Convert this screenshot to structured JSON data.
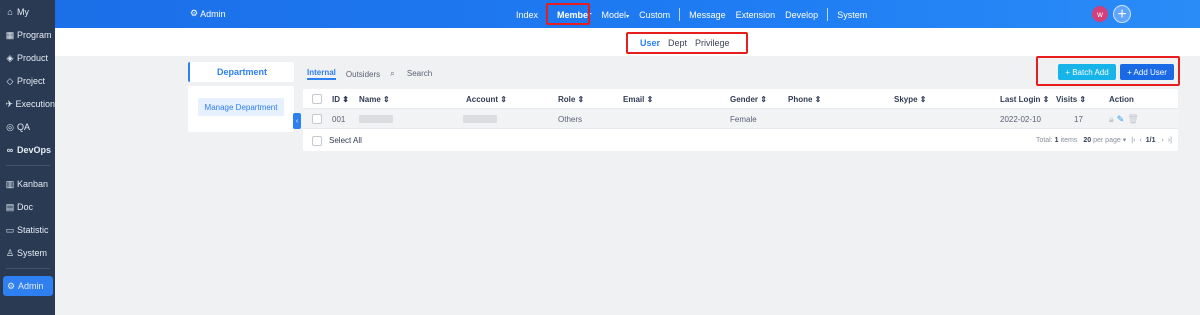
{
  "sidebar": {
    "items": [
      {
        "icon": "home-icon",
        "glyph": "⌂",
        "label": "My"
      },
      {
        "icon": "program-icon",
        "glyph": "▦",
        "label": "Program"
      },
      {
        "icon": "product-icon",
        "glyph": "◈",
        "label": "Product"
      },
      {
        "icon": "project-icon",
        "glyph": "◇",
        "label": "Project"
      },
      {
        "icon": "execution-icon",
        "glyph": "✈",
        "label": "Execution"
      },
      {
        "icon": "qa-icon",
        "glyph": "◎",
        "label": "QA"
      },
      {
        "icon": "devops-icon",
        "glyph": "∞",
        "label": "DevOps"
      },
      {
        "icon": "kanban-icon",
        "glyph": "▥",
        "label": "Kanban"
      },
      {
        "icon": "doc-icon",
        "glyph": "▤",
        "label": "Doc"
      },
      {
        "icon": "statistic-icon",
        "glyph": "▭",
        "label": "Statistic"
      },
      {
        "icon": "system-icon",
        "glyph": "♙",
        "label": "System"
      },
      {
        "icon": "admin-icon",
        "glyph": "⚙",
        "label": "Admin"
      }
    ]
  },
  "header": {
    "title": "Admin",
    "nav": [
      "Index",
      "Member",
      "Model",
      "Custom",
      "Message",
      "Extension",
      "Develop",
      "System"
    ],
    "active": "Member",
    "model_caret": "▾",
    "avatar_letter": "w",
    "plus": "+"
  },
  "subnav": {
    "items": [
      "User",
      "Dept",
      "Privilege"
    ],
    "active": "User"
  },
  "department": {
    "tab_label": "Department",
    "manage_label": "Manage Department",
    "collapse": "‹"
  },
  "toolbar": {
    "tabs": [
      "Internal",
      "Outsiders",
      "Search"
    ],
    "active_tab": "Internal",
    "search_glyph": "⌕",
    "batch_add": "+ Batch Add",
    "add_user": "+ Add User"
  },
  "table": {
    "columns": [
      "ID ⬍",
      "Name ⇕",
      "Account ⇕",
      "Role ⇕",
      "Email ⇕",
      "Gender ⇕",
      "Phone ⇕",
      "Skype ⇕",
      "Last Login ⇕",
      "Visits ⇕",
      "Action"
    ],
    "rows": [
      {
        "id": "001",
        "name": "",
        "account": "",
        "role": "Others",
        "email": "",
        "gender": "Female",
        "phone": "",
        "skype": "",
        "last_login": "2022-02-10",
        "visits": "17"
      }
    ],
    "select_all": "Select All",
    "pager": {
      "total_prefix": "Total:",
      "total": "1",
      "total_suffix": "items",
      "per_page": "20",
      "per_page_suffix": "per page",
      "caret": "▾",
      "first": "|‹",
      "prev": "‹",
      "page": "1/1",
      "next": "›",
      "last": "›|"
    }
  },
  "colors": {
    "accent": "#2e7ff0",
    "sidebar": "#2a3a52",
    "header": "#1f7cf3",
    "highlight": "#e81e1e"
  }
}
